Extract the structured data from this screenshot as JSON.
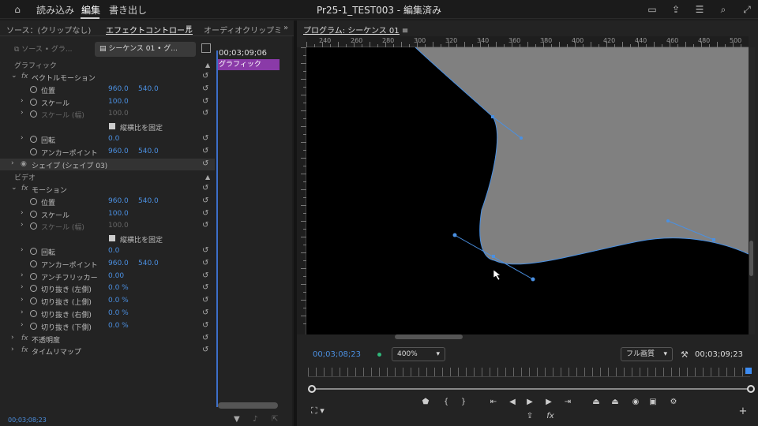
{
  "topbar": {
    "import": "読み込み",
    "edit": "編集",
    "export": "書き出し",
    "title": "Pr25-1_TEST003 - 編集済み"
  },
  "tabs": {
    "source": "ソース：(クリップなし)",
    "effect_controls": "エフェクトコントロール",
    "effect_menu": "≡",
    "audio_mixer": "オーディオクリップミ",
    "more": "»"
  },
  "ec": {
    "source_label": "ソース • グラ...",
    "sequence_label": "シーケンス 01 • グ...",
    "timecode": "00;03;09;06",
    "clip_name": "グラフィック",
    "section_graphic": "グラフィック",
    "section_video": "ビデオ",
    "rows_graphic": [
      {
        "label": "ベクトルモーション",
        "v1": "",
        "v2": ""
      },
      {
        "label": "位置",
        "v1": "960.0",
        "v2": "540.0"
      },
      {
        "label": "スケール",
        "v1": "100.0",
        "v2": ""
      },
      {
        "label": "スケール (幅)",
        "v1": "100.0",
        "v2": ""
      },
      {
        "label": "縦横比を固定",
        "v1": "",
        "v2": ""
      },
      {
        "label": "回転",
        "v1": "0.0",
        "v2": ""
      },
      {
        "label": "アンカーポイント",
        "v1": "960.0",
        "v2": "540.0"
      },
      {
        "label": "シェイプ (シェイプ 03)",
        "v1": "",
        "v2": ""
      }
    ],
    "rows_video": [
      {
        "label": "モーション",
        "v1": "",
        "v2": ""
      },
      {
        "label": "位置",
        "v1": "960.0",
        "v2": "540.0"
      },
      {
        "label": "スケール",
        "v1": "100.0",
        "v2": ""
      },
      {
        "label": "スケール (幅)",
        "v1": "100.0",
        "v2": ""
      },
      {
        "label": "縦横比を固定",
        "v1": "",
        "v2": ""
      },
      {
        "label": "回転",
        "v1": "0.0",
        "v2": ""
      },
      {
        "label": "アンカーポイント",
        "v1": "960.0",
        "v2": "540.0"
      },
      {
        "label": "アンチフリッカー",
        "v1": "0.00",
        "v2": ""
      },
      {
        "label": "切り抜き (左側)",
        "v1": "0.0 %",
        "v2": ""
      },
      {
        "label": "切り抜き (上側)",
        "v1": "0.0 %",
        "v2": ""
      },
      {
        "label": "切り抜き (右側)",
        "v1": "0.0 %",
        "v2": ""
      },
      {
        "label": "切り抜き (下側)",
        "v1": "0.0 %",
        "v2": ""
      },
      {
        "label": "不透明度",
        "v1": "",
        "v2": ""
      },
      {
        "label": "タイムリマップ",
        "v1": "",
        "v2": ""
      }
    ],
    "bottom_timecode": "00;03;08;23"
  },
  "program": {
    "title": "プログラム: シーケンス 01",
    "menu": "≡",
    "timecode_left": "00;03;08;23",
    "zoom": "400%",
    "quality": "フル画質",
    "timecode_right": "00;03;09;23",
    "ruler_labels": [
      "240",
      "260",
      "280",
      "300",
      "320",
      "340",
      "360",
      "380",
      "400",
      "420",
      "440",
      "460",
      "480",
      "500"
    ]
  },
  "colors": {
    "accent": "#4b8fe0",
    "clip": "#8a3aa8",
    "shape": "#808080",
    "path": "#4a90e2"
  }
}
